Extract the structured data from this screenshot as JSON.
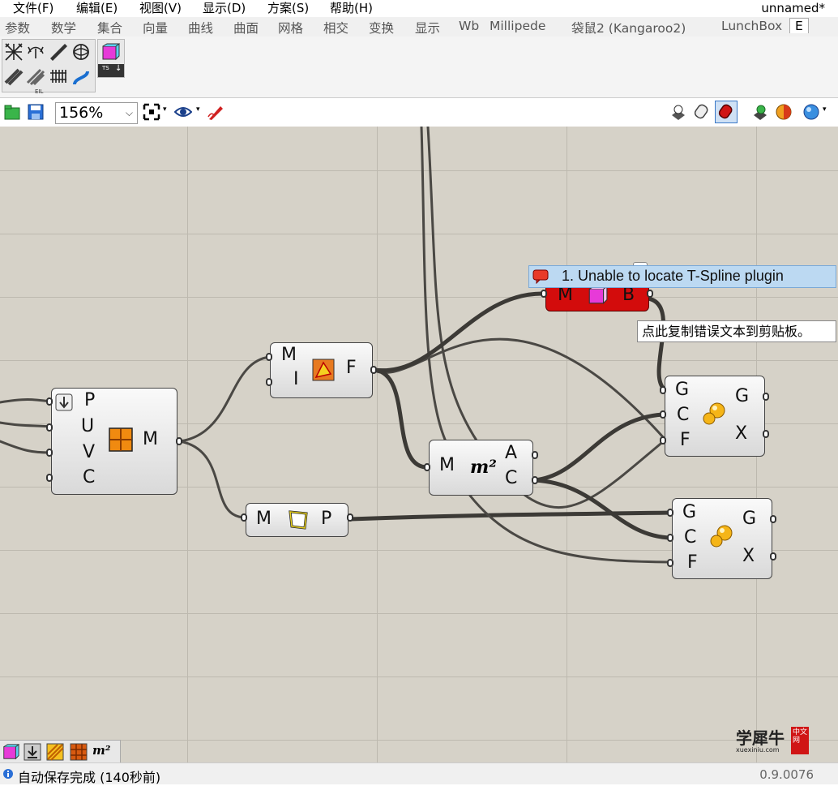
{
  "menu": {
    "items": [
      "文件(F)",
      "编辑(E)",
      "视图(V)",
      "显示(D)",
      "方案(S)",
      "帮助(H)"
    ],
    "doc_title": "unnamed*"
  },
  "tabs": [
    "参数",
    "数学",
    "集合",
    "向量",
    "曲线",
    "曲面",
    "网格",
    "相交",
    "变换",
    "显示",
    "Wb",
    "Millipede",
    "袋鼠2 (Kangaroo2)",
    "LunchBox",
    "E"
  ],
  "ribbon": {
    "group1_icons": [
      "wireframe-mesh-icon",
      "lobster-icon",
      "plane-icon",
      "sphere-mesh-icon",
      "ribbon-icon",
      "grate-icon",
      "fence-icon",
      "curve-icon"
    ],
    "group2_label": "TS",
    "group1_label": "EIL"
  },
  "toolbar": {
    "zoom": "156%"
  },
  "components": {
    "surface_morph": {
      "inputs": [
        "P",
        "U",
        "V",
        "C"
      ],
      "output": "M"
    },
    "face_boundary": {
      "inputs": [
        "M",
        "I"
      ],
      "output": "F"
    },
    "mesh_perimeter": {
      "input": "M",
      "output": "P"
    },
    "area": {
      "input": "M",
      "outputs": [
        "A",
        "C"
      ]
    },
    "tspline_error": {
      "input": "M",
      "output": "B"
    },
    "kangaroo_a": {
      "inputs": [
        "G",
        "C",
        "F"
      ],
      "outputs": [
        "G",
        "X"
      ]
    },
    "kangaroo_b": {
      "inputs": [
        "G",
        "C",
        "F"
      ],
      "outputs": [
        "G",
        "X"
      ]
    }
  },
  "error_tooltip": "1. Unable to locate T-Spline plugin",
  "copy_tooltip": "点此复制错误文本到剪贴板。",
  "status": {
    "text": "自动保存完成 (140秒前)",
    "version": "0.9.0076"
  },
  "watermark": {
    "brand": "学犀牛",
    "url": "xuexiniu.com",
    "badge": "中文网"
  },
  "colors": {
    "canvas": "#d6d2c8",
    "error_component": "#d30c0c",
    "tooltip": "#bcd9f2"
  }
}
